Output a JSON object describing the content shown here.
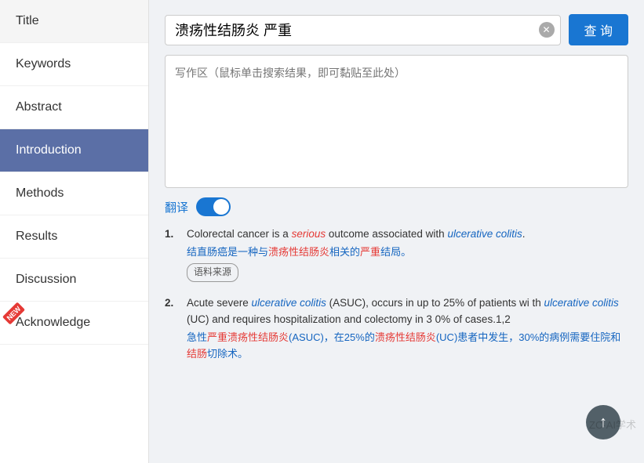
{
  "sidebar": {
    "items": [
      {
        "label": "Title",
        "active": false,
        "newBadge": false
      },
      {
        "label": "Keywords",
        "active": false,
        "newBadge": false
      },
      {
        "label": "Abstract",
        "active": false,
        "newBadge": false
      },
      {
        "label": "Introduction",
        "active": true,
        "newBadge": false
      },
      {
        "label": "Methods",
        "active": false,
        "newBadge": false
      },
      {
        "label": "Results",
        "active": false,
        "newBadge": false
      },
      {
        "label": "Discussion",
        "active": false,
        "newBadge": false
      },
      {
        "label": "Acknowledge",
        "active": false,
        "newBadge": true
      }
    ]
  },
  "search": {
    "value": "溃疡性结肠炎 严重",
    "button_label": "查 询"
  },
  "writing_area": {
    "placeholder": "写作区（鼠标单击搜索结果，即可黏贴至此处）"
  },
  "translate": {
    "label": "翻译",
    "toggle_on": true
  },
  "results": [
    {
      "number": "1.",
      "en_parts": [
        {
          "text": "Colorectal cancer is a ",
          "style": "normal"
        },
        {
          "text": "serious",
          "style": "red-italic"
        },
        {
          "text": " outcome associated with ",
          "style": "normal"
        },
        {
          "text": "ulcerative colitis",
          "style": "blue-italic"
        },
        {
          "text": ".",
          "style": "normal"
        }
      ],
      "zh": "结直肠癌是一种与溃疡性结肠炎相关的严重结局。",
      "zh_parts": [
        {
          "text": "结直肠癌是一种与",
          "style": "normal"
        },
        {
          "text": "溃疡性结肠炎",
          "style": "red"
        },
        {
          "text": "相关的",
          "style": "normal"
        },
        {
          "text": "严重",
          "style": "normal"
        },
        {
          "text": "结局。",
          "style": "normal"
        }
      ],
      "source_tag": "语料来源"
    },
    {
      "number": "2.",
      "en_parts": [
        {
          "text": "Acute severe ",
          "style": "normal"
        },
        {
          "text": "ulcerative colitis",
          "style": "blue-italic"
        },
        {
          "text": " (ASUC), occurs in up to 25% of patients with ",
          "style": "normal"
        },
        {
          "text": "ulcerative colitis",
          "style": "blue-italic"
        },
        {
          "text": " (UC) and requires hospitalization and colectomy in 30% of cases.1,2",
          "style": "normal"
        }
      ],
      "zh": "急性严重溃疡性结肠炎(ASUC)，在25%的溃疡性结肠炎(UC)患者中发生，30%的病例需要住院和结肠切除术。",
      "zh_parts": [
        {
          "text": "急性",
          "style": "normal"
        },
        {
          "text": "严重溃疡性结肠炎",
          "style": "red"
        },
        {
          "text": "(ASUC)，在25%的",
          "style": "normal"
        },
        {
          "text": "溃疡性结肠炎",
          "style": "red"
        },
        {
          "text": "(UC)患者中发生，30%的病例需要住院和",
          "style": "normal"
        },
        {
          "text": "结肠",
          "style": "red"
        },
        {
          "text": "切除术。",
          "style": "normal"
        }
      ]
    }
  ],
  "watermark": "ZC·AI学术"
}
